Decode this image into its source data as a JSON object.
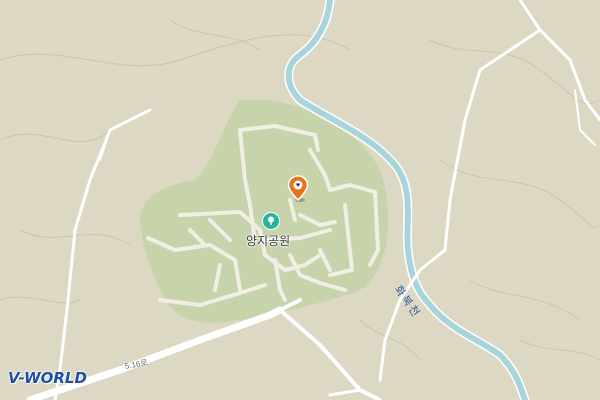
{
  "map": {
    "park_label": "양지공원",
    "road_label": "5.16로",
    "river_label": "화북천",
    "logo_text": "V-WORLD",
    "colors": {
      "land": "#dcd8c4",
      "park": "#c7d4ab",
      "road": "#ffffff",
      "river": "#a8d4dc",
      "contour": "#c9c4ae",
      "park_icon": "#28b39c",
      "pin": "#e8731e",
      "logo": "#1f4fa3"
    },
    "icons": {
      "park": "tree-icon",
      "pin": "location-pin-icon"
    }
  }
}
